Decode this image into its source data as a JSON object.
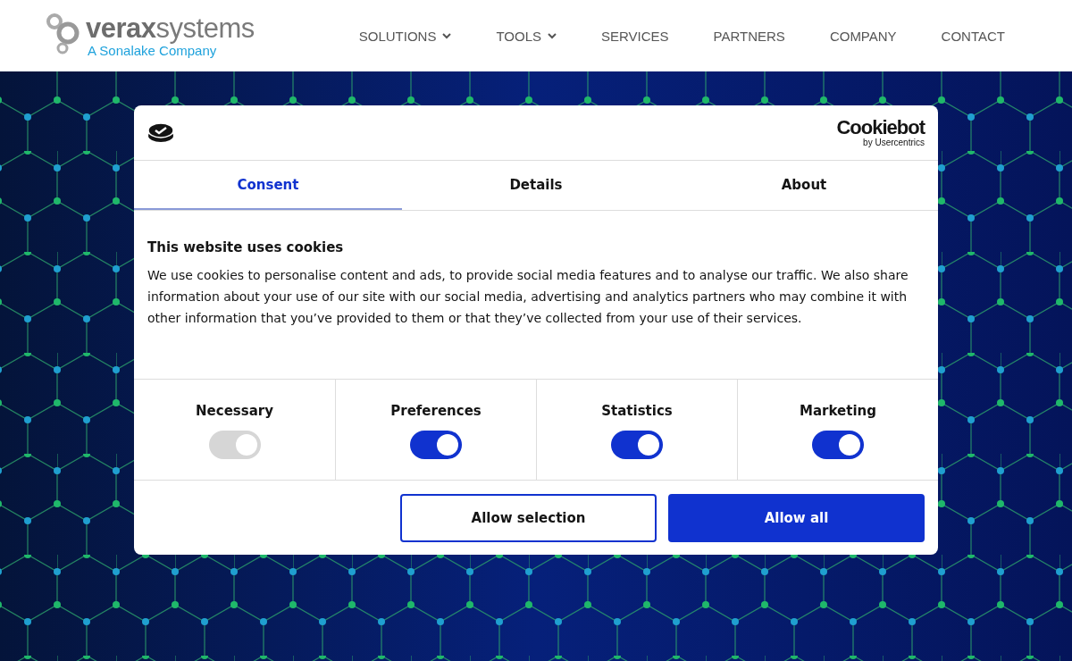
{
  "header": {
    "logo": {
      "name": "**verax**systems",
      "tagline": "A Sonalake Company"
    },
    "nav": [
      {
        "label": "SOLUTIONS",
        "dropdown": true
      },
      {
        "label": "TOOLS",
        "dropdown": true
      },
      {
        "label": "SERVICES",
        "dropdown": false
      },
      {
        "label": "PARTNERS",
        "dropdown": false
      },
      {
        "label": "COMPANY",
        "dropdown": false
      },
      {
        "label": "CONTACT",
        "dropdown": false
      }
    ]
  },
  "dialog": {
    "brand": {
      "name": "Cookiebot",
      "byline": "by Usercentrics"
    },
    "tabs": [
      {
        "label": "Consent",
        "selected": true
      },
      {
        "label": "Details",
        "selected": false
      },
      {
        "label": "About",
        "selected": false
      }
    ],
    "title": "This website uses cookies",
    "body": "We use cookies to personalise content and ads, to provide social media features and to analyse our traffic. We also share information about your use of our site with our social media, advertising and analytics partners who may combine it with other information that you’ve provided to them or that they’ve collected from your use of their services.",
    "categories": [
      {
        "label": "Necessary",
        "checked": true,
        "disabled": true
      },
      {
        "label": "Preferences",
        "checked": true,
        "disabled": false
      },
      {
        "label": "Statistics",
        "checked": true,
        "disabled": false
      },
      {
        "label": "Marketing",
        "checked": true,
        "disabled": false
      }
    ],
    "buttons": [
      {
        "label": "Allow selection",
        "kind": "outline"
      },
      {
        "label": "Allow all",
        "kind": "primary"
      }
    ]
  }
}
